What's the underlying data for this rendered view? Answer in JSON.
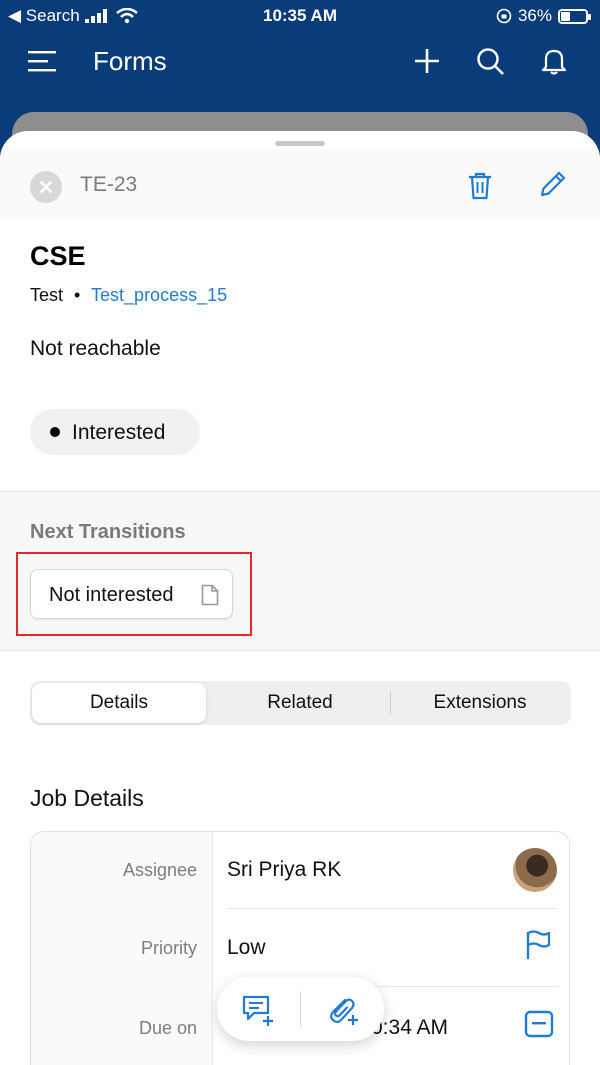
{
  "status_bar": {
    "back_label": "◀ Search",
    "time": "10:35 AM",
    "battery": "36%",
    "battery_level": 0.36
  },
  "app_bar": {
    "title": "Forms",
    "icons": [
      "menu-icon",
      "plus-icon",
      "search-icon",
      "bell-icon"
    ]
  },
  "record": {
    "id": "TE-23",
    "title": "CSE",
    "breadcrumb": {
      "parent": "Test",
      "separator": "•",
      "process": "Test_process_15"
    },
    "description": "Not reachable",
    "state": "Interested"
  },
  "next_transitions": {
    "heading": "Next Transitions",
    "items": [
      "Not interested"
    ]
  },
  "tabs": [
    {
      "label": "Details",
      "active": true
    },
    {
      "label": "Related",
      "active": false
    },
    {
      "label": "Extensions",
      "active": false
    }
  ],
  "job_details": {
    "title": "Job Details",
    "rows": [
      {
        "label": "Assignee",
        "value": "Sri Priya RK"
      },
      {
        "label": "Priority",
        "value": "Low"
      },
      {
        "label": "Due on",
        "value": "0:34 AM"
      }
    ]
  },
  "fab": {
    "icons": [
      "comment-add-icon",
      "attachment-add-icon"
    ]
  },
  "colors": {
    "header_bg": "#0b3c7a",
    "accent": "#1f7bd3",
    "highlight_border": "#e32a2a"
  }
}
